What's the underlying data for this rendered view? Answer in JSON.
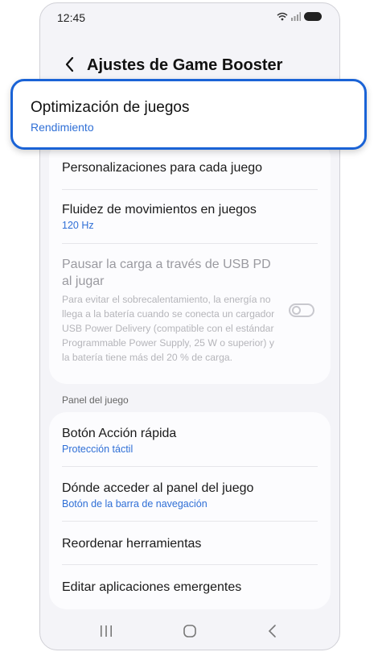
{
  "status_bar": {
    "time": "12:45"
  },
  "header": {
    "title": "Ajustes de Game Booster"
  },
  "highlight": {
    "title": "Optimización de juegos",
    "value": "Rendimiento"
  },
  "settings": {
    "personalizations": "Personalizaciones para cada juego",
    "smoothness": {
      "title": "Fluidez de movimientos en juegos",
      "value": "120 Hz"
    },
    "pause_charging": {
      "title": "Pausar la carga a través de USB PD al jugar",
      "description": "Para evitar el sobrecalentamiento, la energía no llega a la batería cuando se conecta un cargador USB Power Delivery (compatible con el estándar Programmable Power Supply, 25 W o superior) y la batería tiene más del 20 % de carga.",
      "enabled": false
    }
  },
  "game_panel": {
    "section_label": "Panel del juego",
    "quick_action": {
      "title": "Botón Acción rápida",
      "value": "Protección táctil"
    },
    "access": {
      "title": "Dónde acceder al panel del juego",
      "value": "Botón de la barra de navegación"
    },
    "reorder": "Reordenar herramientas",
    "popups": "Editar aplicaciones emergentes"
  },
  "colors": {
    "accent": "#2f6fd6",
    "highlight_border": "#1a63d6",
    "background": "#f4f4f8"
  }
}
